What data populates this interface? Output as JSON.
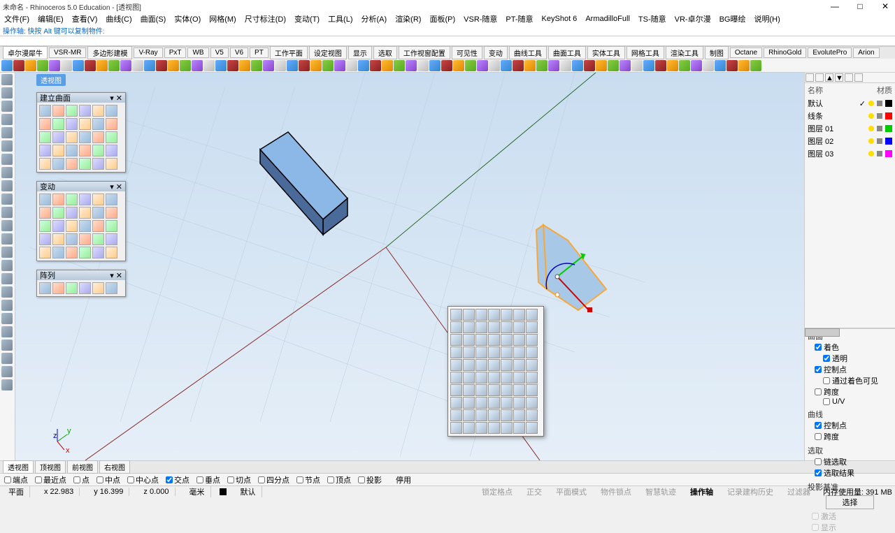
{
  "title": "未命名 - Rhinoceros 5.0 Education - [透视图]",
  "menu": [
    "文件(F)",
    "编辑(E)",
    "查看(V)",
    "曲线(C)",
    "曲面(S)",
    "实体(O)",
    "网格(M)",
    "尺寸标注(D)",
    "变动(T)",
    "工具(L)",
    "分析(A)",
    "渲染(R)",
    "面板(P)",
    "VSR-随意",
    "PT-随意",
    "KeyShot 6",
    "ArmadilloFull",
    "TS-随意",
    "VR-卓尔漫",
    "BG曝绘",
    "说明(H)"
  ],
  "cmdline": "操作轴: 快按 Alt 键可以复制物件:",
  "tabs": [
    "卓尔漫犀牛",
    "VSR-MR",
    "多边形建模",
    "V-Ray",
    "PxT",
    "WB",
    "V5",
    "V6",
    "PT",
    "工作平面",
    "设定视图",
    "显示",
    "选取",
    "工作视窗配置",
    "可见性",
    "变动",
    "曲线工具",
    "曲面工具",
    "实体工具",
    "网格工具",
    "渲染工具",
    "制图",
    "Octane",
    "RhinoGold",
    "EvolutePro",
    "Arion"
  ],
  "viewport_label": "透视图",
  "panels": {
    "p1": {
      "title": "建立曲面",
      "icons": 30
    },
    "p2": {
      "title": "变动",
      "icons": 30
    },
    "p3": {
      "title": "阵列",
      "icons": 6
    }
  },
  "popup_icons": 70,
  "right": {
    "cols": [
      "名称",
      "材质"
    ],
    "layers": [
      {
        "name": "默认",
        "color": "#000",
        "check": true
      },
      {
        "name": "线条",
        "color": "#f00"
      },
      {
        "name": "图层 01",
        "color": "#0c0"
      },
      {
        "name": "图层 02",
        "color": "#00f"
      },
      {
        "name": "图层 03",
        "color": "#f0f"
      }
    ],
    "groups": [
      {
        "title": "曲面",
        "items": [
          {
            "label": "着色",
            "checked": true,
            "sub": [
              {
                "label": "透明",
                "checked": true
              }
            ]
          },
          {
            "label": "控制点",
            "checked": true,
            "sub": [
              {
                "label": "通过着色可见",
                "checked": false
              }
            ]
          },
          {
            "label": "跨度",
            "checked": false,
            "sub": [
              {
                "label": "U/V",
                "checked": false
              }
            ]
          }
        ]
      },
      {
        "title": "曲线",
        "items": [
          {
            "label": "控制点",
            "checked": true
          },
          {
            "label": "跨度",
            "checked": false
          }
        ]
      },
      {
        "title": "选取",
        "items": [
          {
            "label": "链选取",
            "checked": false
          },
          {
            "label": "选取结果",
            "checked": true
          }
        ]
      },
      {
        "title": "投影基准",
        "items": []
      }
    ],
    "proj_btn": "选择",
    "proj_items": [
      {
        "label": "激活"
      },
      {
        "label": "显示"
      }
    ]
  },
  "bottom_tabs": [
    "透视图",
    "顶视图",
    "前视图",
    "右视图"
  ],
  "osnap": [
    {
      "label": "端点",
      "checked": false
    },
    {
      "label": "最近点",
      "checked": false
    },
    {
      "label": "点",
      "checked": false
    },
    {
      "label": "中点",
      "checked": false
    },
    {
      "label": "中心点",
      "checked": false
    },
    {
      "label": "交点",
      "checked": true
    },
    {
      "label": "垂点",
      "checked": false
    },
    {
      "label": "切点",
      "checked": false
    },
    {
      "label": "四分点",
      "checked": false
    },
    {
      "label": "节点",
      "checked": false
    },
    {
      "label": "顶点",
      "checked": false
    },
    {
      "label": "投影",
      "checked": false
    }
  ],
  "osnap_disable": "停用",
  "status": {
    "plane": "平面",
    "x": "x 22.983",
    "y": "y 16.399",
    "z": "z 0.000",
    "unit": "毫米",
    "layer": "默认",
    "toggles": [
      "锁定格点",
      "正交",
      "平面模式",
      "物件锁点",
      "智慧轨迹",
      "操作轴",
      "记录建构历史",
      "过滤器"
    ],
    "mem": "内存使用量: 391 MB"
  },
  "axis_labels": {
    "x": "x",
    "y": "y",
    "z": "z"
  }
}
